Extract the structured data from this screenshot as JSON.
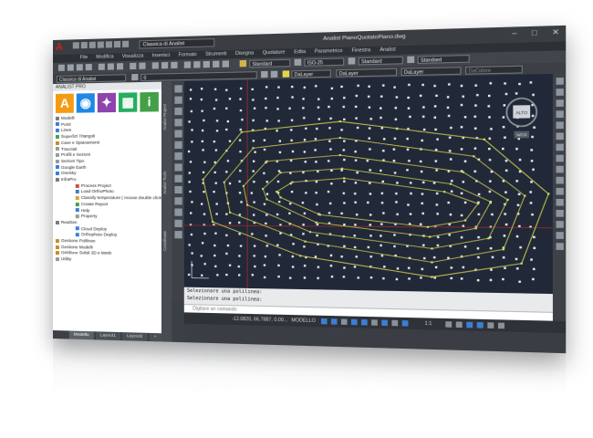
{
  "app": {
    "logo": "A",
    "workspace": "Classica di Analist",
    "title": "Analist   PianoQuotatoPiano.dwg",
    "controls": [
      "–",
      "□",
      "✕"
    ]
  },
  "menu": [
    "File",
    "Modifica",
    "Visualizza",
    "Inserisci",
    "Formato",
    "Strumenti",
    "Disegna",
    "Quotature",
    "Edita",
    "Parametrico",
    "Finestra",
    "Analist"
  ],
  "toolbar": {
    "text_style": "Standard",
    "dim_style": "ISO-25",
    "table_style": "Standard",
    "multileader_style": "Standard",
    "workspace_combo": "Classica di Analist",
    "layer": "0",
    "color": "DaLayer",
    "linetype": "DaLayer",
    "lineweight": "DaLayer",
    "plot_style": "DaColore"
  },
  "panel": {
    "title": "ANALIST PRO",
    "tiles": [
      {
        "label": "A",
        "color": "#f39c12",
        "icon": "analist-icon"
      },
      {
        "label": "",
        "color": "#1e88e5",
        "icon": "globe-icon"
      },
      {
        "label": "",
        "color": "#8e44ad",
        "icon": "satellite-icon"
      },
      {
        "label": "",
        "color": "#27ae60",
        "icon": "map-icon"
      },
      {
        "label": "i",
        "color": "#43a047",
        "icon": "info-icon"
      }
    ],
    "tree": [
      {
        "label": "Modelli",
        "level": 0,
        "color": "#7a7a7a"
      },
      {
        "label": "Punti",
        "level": 0,
        "color": "#3a7fd4"
      },
      {
        "label": "Linee",
        "level": 0,
        "color": "#3a7fd4"
      },
      {
        "label": "Superfici Triangoli",
        "level": 0,
        "color": "#3fa34d"
      },
      {
        "label": "Cave e Spianamenti",
        "level": 0,
        "color": "#c58b2a"
      },
      {
        "label": "Tracciati",
        "level": 0,
        "color": "#999999"
      },
      {
        "label": "Profili e Sezioni",
        "level": 0,
        "color": "#999999"
      },
      {
        "label": "Sezioni Tipo",
        "level": 0,
        "color": "#999999"
      },
      {
        "label": "Google Earth",
        "level": 0,
        "color": "#3a7fd4"
      },
      {
        "label": "OneSky",
        "level": 0,
        "color": "#3a7fd4"
      },
      {
        "label": "InfraPro",
        "level": 0,
        "color": "#7a7a7a"
      },
      {
        "label": "Process Project",
        "level": 1,
        "color": "#d64a4a"
      },
      {
        "label": "Load OrthoPhoto",
        "level": 1,
        "color": "#3a7fd4"
      },
      {
        "label": "Classify temperature ( mouse double click )",
        "level": 1,
        "color": "#e0a030"
      },
      {
        "label": "Create Report",
        "level": 1,
        "color": "#3fa34d"
      },
      {
        "label": "Help",
        "level": 1,
        "color": "#3a7fd4"
      },
      {
        "label": "Property",
        "level": 1,
        "color": "#999999"
      },
      {
        "label": "RealSim",
        "level": 0,
        "color": "#7a7a7a"
      },
      {
        "label": "Cloud Deploy",
        "level": 1,
        "color": "#3a7fd4"
      },
      {
        "label": "Orthophoto Deploy",
        "level": 1,
        "color": "#3a7fd4"
      },
      {
        "label": "Gestione Polilinee",
        "level": 0,
        "color": "#c58b2a"
      },
      {
        "label": "Gestione Modelli",
        "level": 0,
        "color": "#c58b2a"
      },
      {
        "label": "Gestione Solidi 3D e Mesh",
        "level": 0,
        "color": "#c58b2a"
      },
      {
        "label": "Utility",
        "level": 0,
        "color": "#999999"
      }
    ],
    "tabs": [
      "Modello",
      "Layout1",
      "Layout2",
      "+"
    ],
    "side_tabs": [
      "Analist Project",
      "Analist Tools",
      "Coordinate"
    ]
  },
  "viewcube": {
    "label": "ALTO",
    "wcs": "WCS"
  },
  "command": {
    "history": [
      "Selezionare una polilinea:",
      "Selezionare una polilinea:"
    ],
    "placeholder": "Digitare un comando"
  },
  "status": {
    "coords": "-12.0820, 66.7887, 0.00...",
    "space": "MODELLO",
    "scale": "1:1"
  },
  "colors": {
    "canvas": "#212838",
    "contour": "#c8c84a",
    "axis_x": "#a02a2a"
  }
}
